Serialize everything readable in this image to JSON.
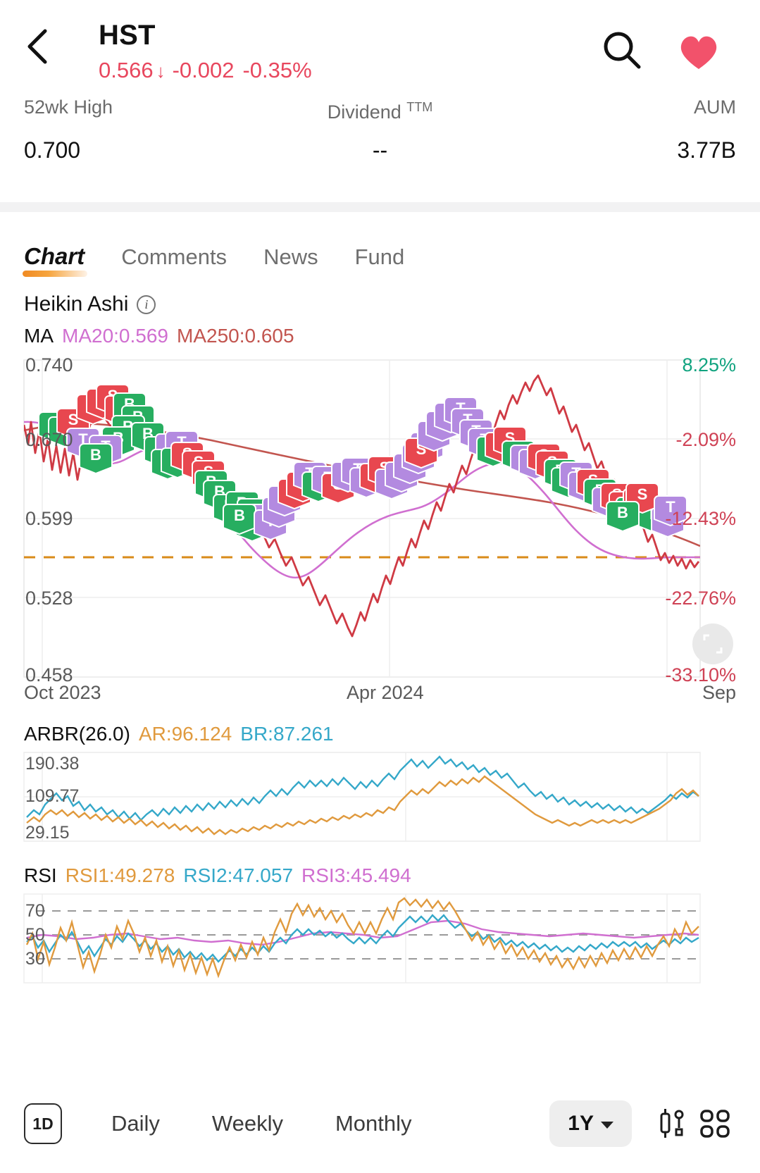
{
  "header": {
    "back_icon": "chevron-left-icon",
    "symbol": "HST",
    "price": "0.566",
    "arrow": "↓",
    "change": "-0.002",
    "change_pct": "-0.35%",
    "search_icon": "search-icon",
    "favorite_icon": "heart-icon",
    "down_color": "#e8475e"
  },
  "stats": [
    {
      "label": "52wk High",
      "sup": "",
      "value": "0.700"
    },
    {
      "label": "Dividend",
      "sup": "TTM",
      "value": "--"
    },
    {
      "label": "AUM",
      "sup": "",
      "value": "3.77B"
    }
  ],
  "tabs": [
    {
      "label": "Chart",
      "active": true
    },
    {
      "label": "Comments",
      "active": false
    },
    {
      "label": "News",
      "active": false
    },
    {
      "label": "Fund",
      "active": false
    }
  ],
  "chart_header": {
    "style_label": "Heikin Ashi",
    "info_icon": "info-icon",
    "ma_label": "MA",
    "ma20": "MA20:0.569",
    "ma250": "MA250:0.605",
    "ma20_color": "#d06fd0",
    "ma250_color": "#c2554f"
  },
  "fullscreen_icon": "fullscreen-icon",
  "chart_data": [
    {
      "type": "line",
      "name": "price",
      "title": "HST Heikin Ashi price",
      "ylabel": "",
      "xlabel": "",
      "grid": true,
      "y_ticks": [
        "0.740",
        "0.670",
        "0.599",
        "0.528",
        "0.458"
      ],
      "y_values": [
        0.74,
        0.67,
        0.599,
        0.528,
        0.458
      ],
      "ylim": [
        0.458,
        0.74
      ],
      "right_ticks": [
        "8.25%",
        "-2.09%",
        "-12.43%",
        "-22.76%",
        "-33.10%"
      ],
      "right_values": [
        8.25,
        -2.09,
        -12.43,
        -22.76,
        -33.1
      ],
      "right_tick_colors": [
        "#10a37f",
        "#cf4255",
        "#cf4255",
        "#cf4255",
        "#cf4255"
      ],
      "x_ticks": [
        "Oct 2023",
        "Apr 2024",
        "Sep"
      ],
      "baseline": {
        "value": 0.566,
        "color": "#d98b1a",
        "style": "dashed"
      },
      "series": [
        {
          "name": "Close",
          "color": "#cf3a44",
          "values": [
            0.69,
            0.668,
            0.682,
            0.648,
            0.661,
            0.635,
            0.651,
            0.628,
            0.64,
            0.618,
            0.655,
            0.63,
            0.644,
            0.62,
            0.636,
            0.614,
            0.648,
            0.66,
            0.676,
            0.69,
            0.7,
            0.688,
            0.678,
            0.69,
            0.7,
            0.694,
            0.686,
            0.692,
            0.686,
            0.672,
            0.678,
            0.664,
            0.65,
            0.656,
            0.644,
            0.632,
            0.64,
            0.628,
            0.618,
            0.624,
            0.61,
            0.598,
            0.604,
            0.594,
            0.586,
            0.592,
            0.58,
            0.572,
            0.578,
            0.566,
            0.556,
            0.562,
            0.552,
            0.544,
            0.55,
            0.54,
            0.532,
            0.538,
            0.528,
            0.52,
            0.526,
            0.518,
            0.51,
            0.516,
            0.508,
            0.504,
            0.512,
            0.52,
            0.516,
            0.524,
            0.532,
            0.528,
            0.536,
            0.544,
            0.54,
            0.548,
            0.556,
            0.552,
            0.56,
            0.568,
            0.564,
            0.572,
            0.58,
            0.576,
            0.584,
            0.592,
            0.588,
            0.596,
            0.592,
            0.6,
            0.596,
            0.604,
            0.6,
            0.608,
            0.604,
            0.598,
            0.606,
            0.6,
            0.608,
            0.616,
            0.624,
            0.636,
            0.65,
            0.664,
            0.676,
            0.688,
            0.7,
            0.694,
            0.686,
            0.692,
            0.684,
            0.676,
            0.668,
            0.66,
            0.652,
            0.644,
            0.636,
            0.628,
            0.62,
            0.612,
            0.604,
            0.598,
            0.592,
            0.586,
            0.58,
            0.574,
            0.57,
            0.566,
            0.572,
            0.568,
            0.564,
            0.57,
            0.566,
            0.562,
            0.568,
            0.564,
            0.56,
            0.566
          ]
        },
        {
          "name": "MA20",
          "color": "#d06fd0",
          "last": 0.569
        },
        {
          "name": "MA250",
          "color": "#c2554f",
          "last": 0.605
        }
      ],
      "markers": {
        "buy": {
          "letter": "B",
          "color": "#27ae60"
        },
        "sell": {
          "letter": "S",
          "color": "#e8474f"
        },
        "trend": {
          "letter": "T",
          "color": "#b38ae0"
        }
      }
    },
    {
      "type": "line",
      "name": "ARBR",
      "title": "ARBR(26.0)",
      "legend": [
        {
          "label": "AR:96.124",
          "color": "#e09a3e",
          "value": 96.124
        },
        {
          "label": "BR:87.261",
          "color": "#35a8c9",
          "value": 87.261
        }
      ],
      "y_ticks": [
        "190.38",
        "109.77",
        "29.15"
      ],
      "y_values": [
        190.38,
        109.77,
        29.15
      ],
      "ylim": [
        29.15,
        190.38
      ],
      "grid": true
    },
    {
      "type": "line",
      "name": "RSI",
      "title": "RSI",
      "legend": [
        {
          "label": "RSI1:49.278",
          "color": "#e09a3e",
          "value": 49.278
        },
        {
          "label": "RSI2:47.057",
          "color": "#35a8c9",
          "value": 47.057
        },
        {
          "label": "RSI3:45.494",
          "color": "#d06fd0",
          "value": 45.494
        }
      ],
      "y_ticks": [
        "70",
        "50",
        "30"
      ],
      "y_values": [
        70,
        50,
        30
      ],
      "ylim": [
        10,
        85
      ],
      "grid": true,
      "guide_lines": [
        70,
        50,
        30
      ]
    }
  ],
  "bottom_bar": {
    "interval_badge": "1D",
    "periods": [
      "Daily",
      "Weekly",
      "Monthly"
    ],
    "range_selected": "1Y",
    "settings_icon": "candle-settings-icon",
    "layout_icon": "grid-layout-icon"
  }
}
